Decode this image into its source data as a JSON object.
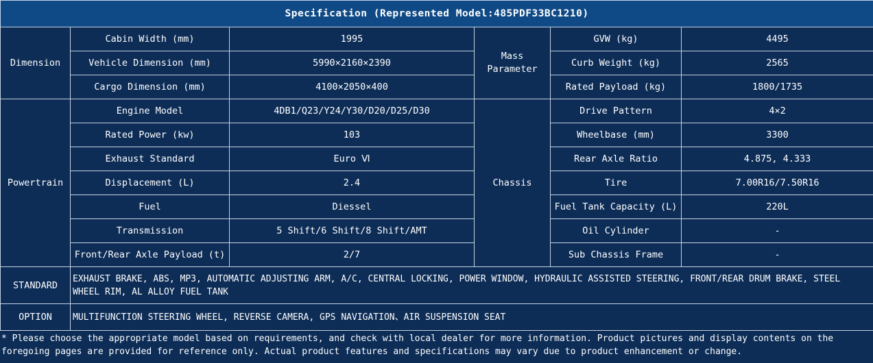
{
  "title": "Specification (Represented Model:485PDF33BC1210)",
  "groups": {
    "dimension": "Dimension",
    "mass": "Mass Parameter",
    "powertrain": "Powertrain",
    "chassis": "Chassis"
  },
  "rows": [
    {
      "l_label": "Cabin Width (mm)",
      "l_value": "1995",
      "r_label": "GVW (kg)",
      "r_value": "4495"
    },
    {
      "l_label": "Vehicle Dimension (mm)",
      "l_value": "5990×2160×2390",
      "r_label": "Curb Weight (kg)",
      "r_value": "2565"
    },
    {
      "l_label": "Cargo Dimension (mm)",
      "l_value": "4100×2050×400",
      "r_label": "Rated Payload (kg)",
      "r_value": "1800/1735"
    },
    {
      "l_label": "Engine Model",
      "l_value": "4DB1/Q23/Y24/Y30/D20/D25/D30",
      "r_label": "Drive Pattern",
      "r_value": "4×2"
    },
    {
      "l_label": "Rated Power (kw)",
      "l_value": "103",
      "r_label": "Wheelbase (mm)",
      "r_value": "3300"
    },
    {
      "l_label": "Exhaust Standard",
      "l_value": "Euro Ⅵ",
      "r_label": "Rear Axle Ratio",
      "r_value": "4.875, 4.333"
    },
    {
      "l_label": "Displacement (L)",
      "l_value": "2.4",
      "r_label": "Tire",
      "r_value": "7.00R16/7.50R16"
    },
    {
      "l_label": "Fuel",
      "l_value": "Diessel",
      "r_label": "Fuel Tank Capacity (L)",
      "r_value": "220L"
    },
    {
      "l_label": "Transmission",
      "l_value": "5 Shift/6 Shift/8 Shift/AMT",
      "r_label": "Oil Cylinder",
      "r_value": "-"
    },
    {
      "l_label": "Front/Rear Axle Payload (t)",
      "l_value": "2/7",
      "r_label": "Sub Chassis Frame",
      "r_value": "-"
    }
  ],
  "standard": {
    "label": "STANDARD",
    "text": "EXHAUST BRAKE, ABS, MP3, AUTOMATIC ADJUSTING ARM, A/C, CENTRAL LOCKING, POWER WINDOW, HYDRAULIC ASSISTED STEERING, FRONT/REAR DRUM BRAKE, STEEL WHEEL RIM, AL ALLOY FUEL TANK"
  },
  "option": {
    "label": "OPTION",
    "text": "MULTIFUNCTION STEERING WHEEL, REVERSE CAMERA, GPS NAVIGATION、AIR SUSPENSION SEAT"
  },
  "note": "* Please choose the appropriate model based on requirements, and check with local dealer for more information. Product pictures and display contents on the foregoing pages are provided for reference only. Actual product features and specifications may vary due to product enhancement or change."
}
